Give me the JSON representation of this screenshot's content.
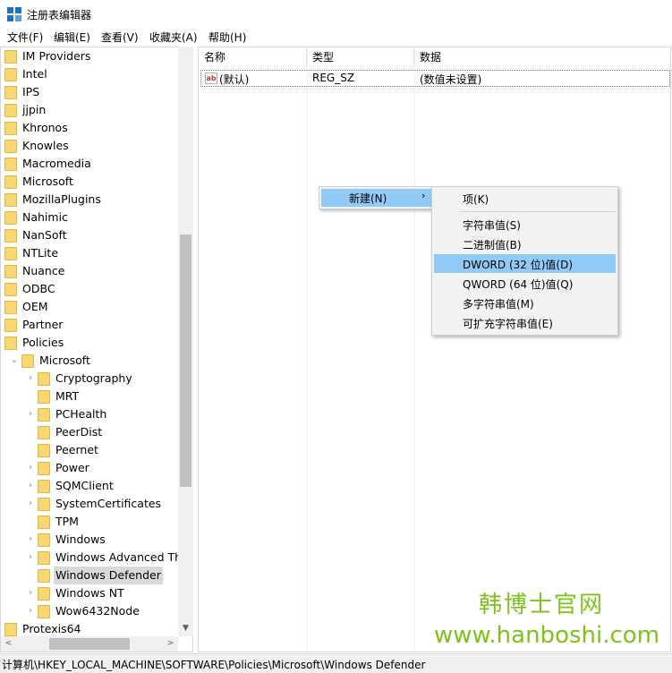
{
  "window": {
    "title": "注册表编辑器",
    "icon": "registry-editor-icon",
    "accent": "#1e73c9"
  },
  "menu": [
    "文件(F)",
    "编辑(E)",
    "查看(V)",
    "收藏夹(A)",
    "帮助(H)"
  ],
  "tree": {
    "items": [
      {
        "label": "IM Providers",
        "level": 0,
        "expander": "none"
      },
      {
        "label": "Intel",
        "level": 0,
        "expander": "none"
      },
      {
        "label": "IPS",
        "level": 0,
        "expander": "none"
      },
      {
        "label": "jjpin",
        "level": 0,
        "expander": "none"
      },
      {
        "label": "Khronos",
        "level": 0,
        "expander": "none"
      },
      {
        "label": "Knowles",
        "level": 0,
        "expander": "none"
      },
      {
        "label": "Macromedia",
        "level": 0,
        "expander": "none"
      },
      {
        "label": "Microsoft",
        "level": 0,
        "expander": "none"
      },
      {
        "label": "MozillaPlugins",
        "level": 0,
        "expander": "none"
      },
      {
        "label": "Nahimic",
        "level": 0,
        "expander": "none"
      },
      {
        "label": "NanSoft",
        "level": 0,
        "expander": "none"
      },
      {
        "label": "NTLite",
        "level": 0,
        "expander": "none"
      },
      {
        "label": "Nuance",
        "level": 0,
        "expander": "none"
      },
      {
        "label": "ODBC",
        "level": 0,
        "expander": "none"
      },
      {
        "label": "OEM",
        "level": 0,
        "expander": "none"
      },
      {
        "label": "Partner",
        "level": 0,
        "expander": "none"
      },
      {
        "label": "Policies",
        "level": 0,
        "expander": "none"
      },
      {
        "label": "Microsoft",
        "level": 1,
        "expander": "expanded"
      },
      {
        "label": "Cryptography",
        "level": 2,
        "expander": "collapsed"
      },
      {
        "label": "MRT",
        "level": 2,
        "expander": "none"
      },
      {
        "label": "PCHealth",
        "level": 2,
        "expander": "collapsed"
      },
      {
        "label": "PeerDist",
        "level": 2,
        "expander": "none"
      },
      {
        "label": "Peernet",
        "level": 2,
        "expander": "none"
      },
      {
        "label": "Power",
        "level": 2,
        "expander": "collapsed"
      },
      {
        "label": "SQMClient",
        "level": 2,
        "expander": "collapsed"
      },
      {
        "label": "SystemCertificates",
        "level": 2,
        "expander": "collapsed"
      },
      {
        "label": "TPM",
        "level": 2,
        "expander": "none"
      },
      {
        "label": "Windows",
        "level": 2,
        "expander": "collapsed"
      },
      {
        "label": "Windows Advanced Thr",
        "level": 2,
        "expander": "collapsed"
      },
      {
        "label": "Windows Defender",
        "level": 2,
        "expander": "none",
        "selected": true
      },
      {
        "label": "Windows NT",
        "level": 2,
        "expander": "collapsed"
      },
      {
        "label": "Wow6432Node",
        "level": 2,
        "expander": "collapsed"
      },
      {
        "label": "Protexis64",
        "level": 0,
        "expander": "collapsed"
      }
    ]
  },
  "list": {
    "columns": [
      "名称",
      "类型",
      "数据"
    ],
    "rows": [
      {
        "name": "(默认)",
        "type": "REG_SZ",
        "data": "(数值未设置)",
        "icon": "string-value-icon"
      }
    ]
  },
  "context_menu": {
    "new_label": "新建(N)",
    "submenu": [
      "项(K)",
      "字符串值(S)",
      "二进制值(B)",
      "DWORD (32 位)值(D)",
      "QWORD (64 位)值(Q)",
      "多字符串值(M)",
      "可扩充字符串值(E)"
    ],
    "highlighted": "DWORD (32 位)值(D)",
    "highlight_color": "#91c9f7"
  },
  "status": {
    "path": "计算机\\HKEY_LOCAL_MACHINE\\SOFTWARE\\Policies\\Microsoft\\Windows Defender"
  },
  "watermark": {
    "cn": "韩博士官网",
    "url": "www.hanboshi.com",
    "color": "#7fc21c"
  }
}
